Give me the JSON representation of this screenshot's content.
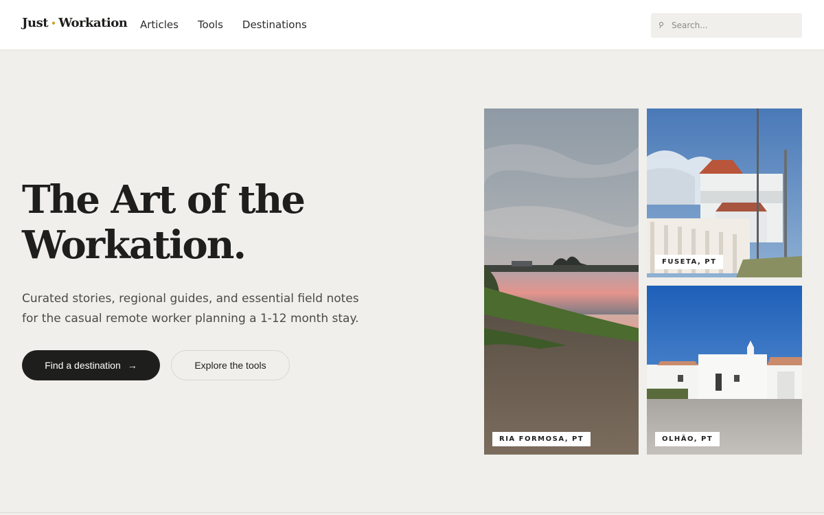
{
  "header": {
    "logo_left": "Just",
    "logo_right": "Workation",
    "nav": [
      {
        "label": "Articles"
      },
      {
        "label": "Tools"
      },
      {
        "label": "Destinations"
      }
    ],
    "search_placeholder": "Search..."
  },
  "hero": {
    "title_line1": "The Art of the",
    "title_line2": "Workation.",
    "subtitle": "Curated stories, regional guides, and essential field notes for the casual remote worker planning a 1-12 month stay.",
    "primary_button": "Find a destination",
    "secondary_button": "Explore the tools"
  },
  "photos": [
    {
      "label": "RIA FORMOSA, PT"
    },
    {
      "label": "FUSETA, PT"
    },
    {
      "label": "OLHÃO, PT"
    }
  ],
  "colors": {
    "background": "#f0efeb",
    "ink": "#1e1e1c",
    "accent_dot": "#c9a227"
  }
}
